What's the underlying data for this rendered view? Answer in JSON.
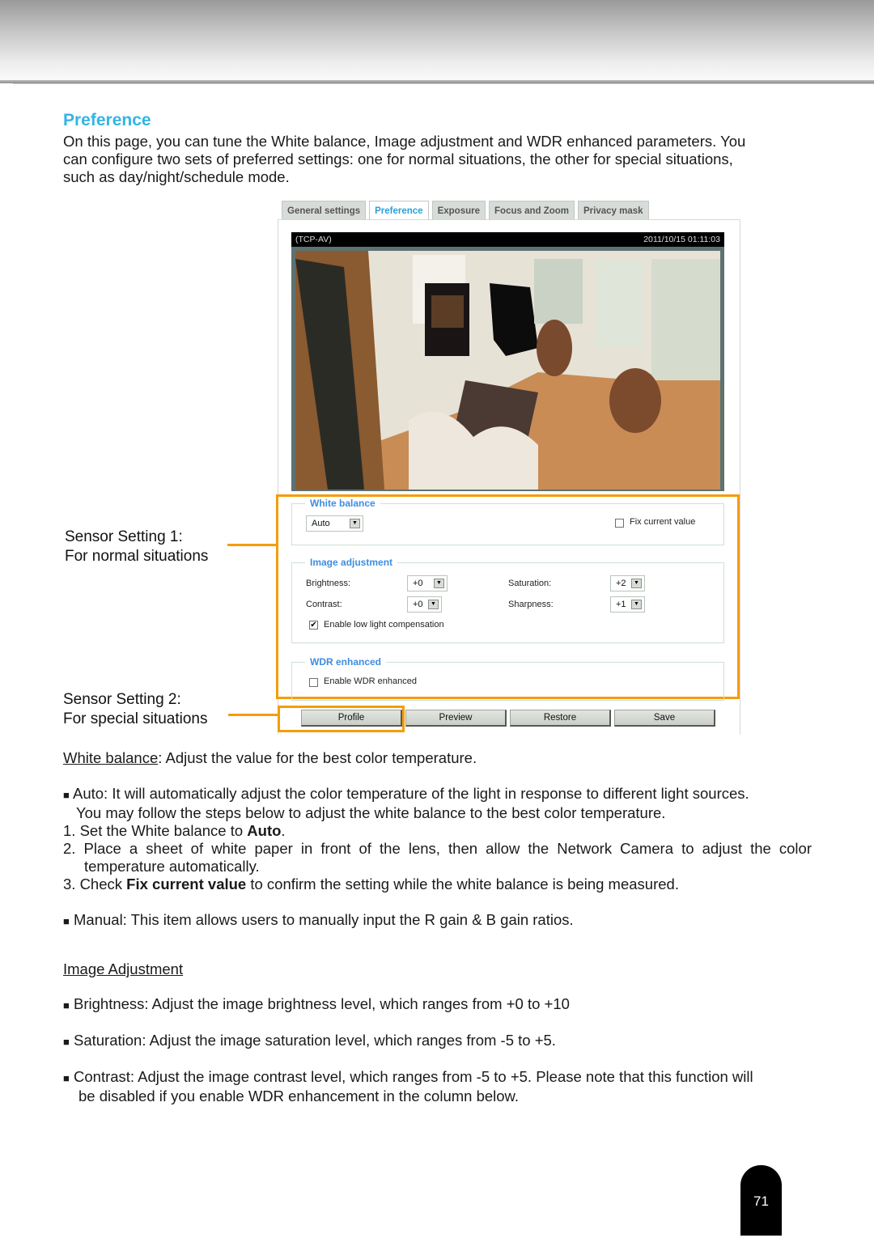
{
  "page": {
    "section_title": "Preference",
    "intro_lines": [
      "On this page, you can tune the White balance, Image adjustment and WDR enhanced parameters. You",
      "can configure two sets of preferred settings: one for normal situations, the other for special situations,",
      "such as day/night/schedule mode."
    ],
    "page_number": "71"
  },
  "ui": {
    "tabs": [
      {
        "label": "General settings",
        "active": false
      },
      {
        "label": "Preference",
        "active": true
      },
      {
        "label": "Exposure",
        "active": false
      },
      {
        "label": "Focus and Zoom",
        "active": false
      },
      {
        "label": "Privacy mask",
        "active": false
      }
    ],
    "video": {
      "stream_label": "(TCP-AV)",
      "timestamp": "2011/10/15 01:11:03"
    },
    "white_balance": {
      "legend": "White balance",
      "mode_value": "Auto",
      "fix_current_label": "Fix current value",
      "fix_current_checked": false
    },
    "image_adjustment": {
      "legend": "Image adjustment",
      "brightness_label": "Brightness:",
      "brightness_value": "+0",
      "contrast_label": "Contrast:",
      "contrast_value": "+0",
      "saturation_label": "Saturation:",
      "saturation_value": "+2",
      "sharpness_label": "Sharpness:",
      "sharpness_value": "+1",
      "low_light_label": "Enable low light compensation",
      "low_light_checked": true
    },
    "wdr": {
      "legend": "WDR enhanced",
      "enable_label": "Enable WDR enhanced",
      "enable_checked": false
    },
    "buttons": {
      "profile": "Profile",
      "preview": "Preview",
      "restore": "Restore",
      "save": "Save"
    },
    "checkmark": "✔",
    "dropdown_arrow": "▼"
  },
  "callouts": {
    "sensor1_line1": "Sensor Setting 1:",
    "sensor1_line2": "For normal situations",
    "sensor2_line1": "Sensor Setting 2:",
    "sensor2_line2": "For special situations"
  },
  "white_balance_section": {
    "heading": "White balance",
    "heading_rest": ": Adjust the value for the best color temperature.",
    "bullet": "■",
    "auto_line1": "Auto: It will automatically adjust the color temperature of the light in response to different light sources.",
    "auto_line2": "You may follow the steps below to adjust the white balance to the best color temperature.",
    "step1_pre": "1. Set the White balance to ",
    "step1_bold": "Auto",
    "step1_post": ".",
    "step2_line1": "2. Place a sheet of white paper in front of the lens, then allow the Network Camera to adjust the color",
    "step2_line2": "temperature automatically.",
    "step3_pre": "3. Check ",
    "step3_bold": "Fix current value",
    "step3_post": " to confirm the setting while the white balance is being measured.",
    "manual": "Manual: This item allows users to manually input the R gain & B gain ratios."
  },
  "image_adjustment_section": {
    "heading": "Image Adjustment",
    "brightness": "Brightness: Adjust the image brightness level, which ranges from +0 to +10",
    "saturation": "Saturation: Adjust the image saturation level, which ranges from -5 to +5.",
    "contrast_line1": "Contrast: Adjust the image contrast level, which ranges from -5 to +5. Please note that this function will",
    "contrast_line2": "be disabled if you enable WDR enhancement in the column below."
  }
}
